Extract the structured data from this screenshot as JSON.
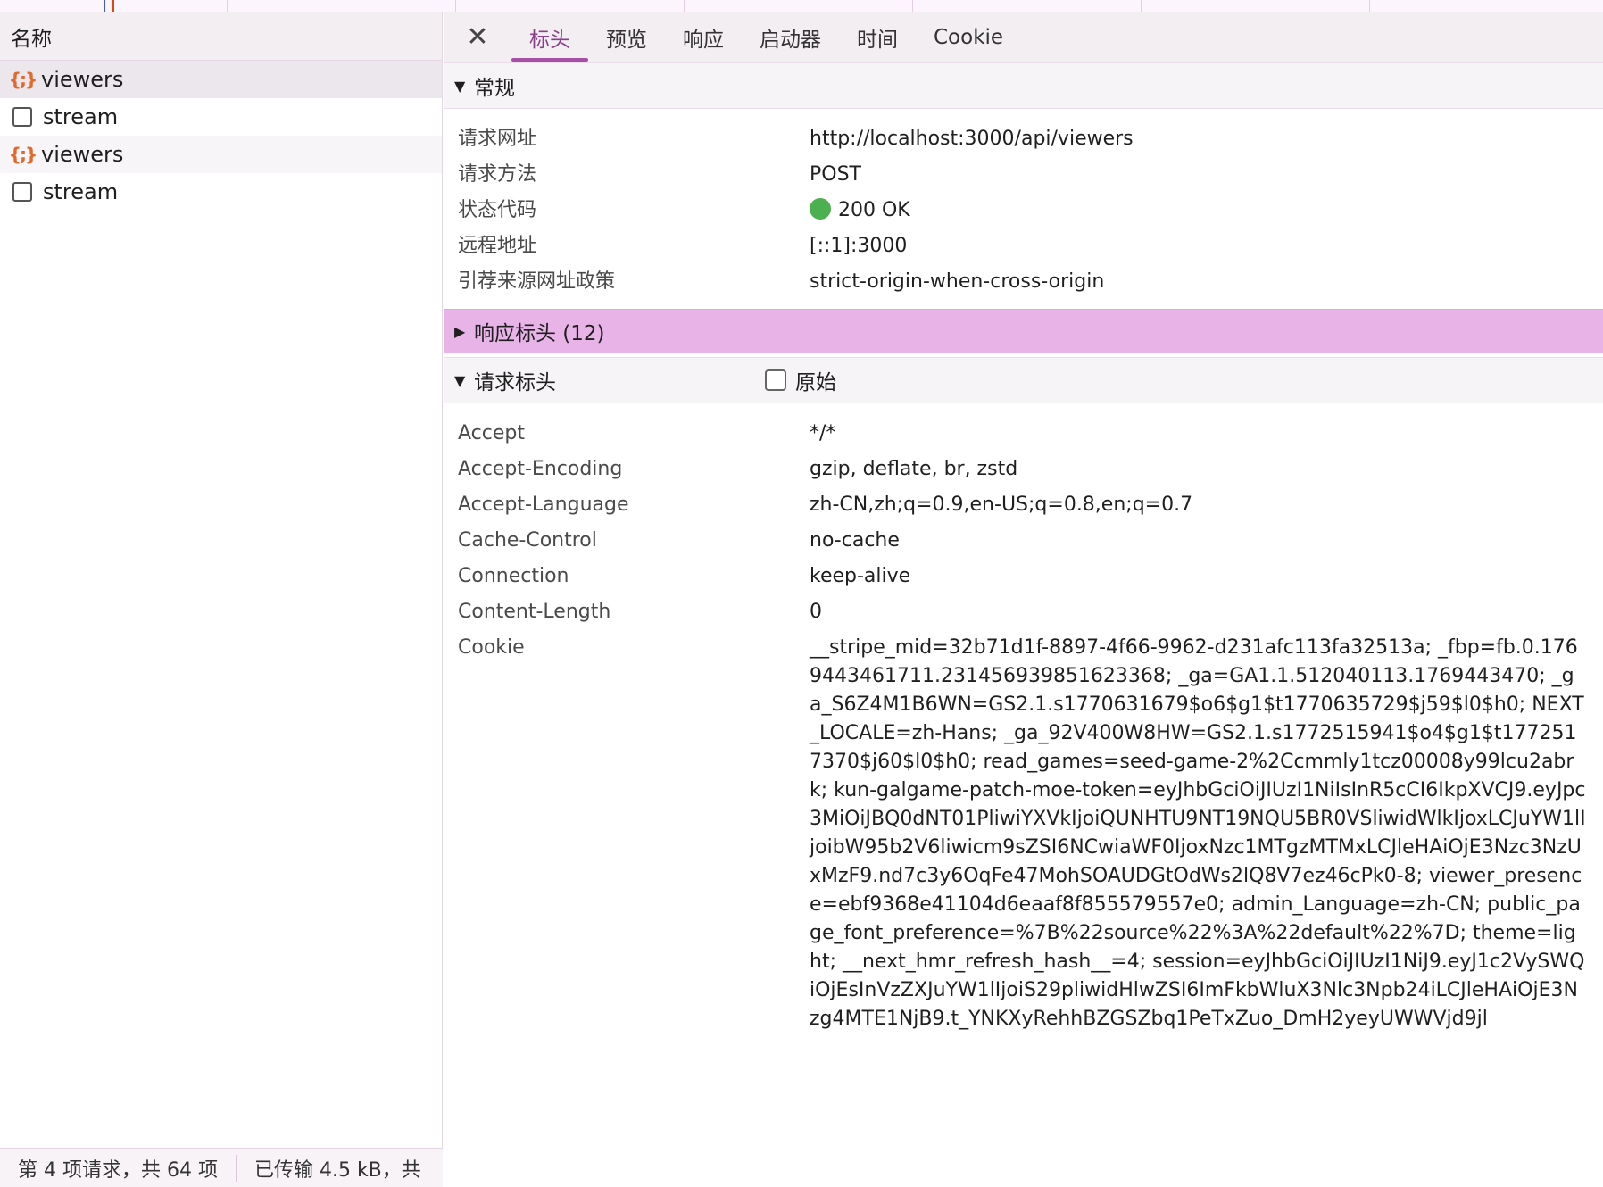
{
  "left_panel": {
    "column_header": "名称",
    "requests": [
      {
        "name": "viewers",
        "type": "fetch-icon"
      },
      {
        "name": "stream",
        "type": "document-icon"
      },
      {
        "name": "viewers",
        "type": "fetch-icon"
      },
      {
        "name": "stream",
        "type": "document-icon"
      }
    ],
    "status": {
      "requests_count": "第 4 项请求，共 64 项",
      "transferred": "已传输 4.5 kB，共"
    }
  },
  "tabs": {
    "close_icon": "close-icon",
    "items": [
      "标头",
      "预览",
      "响应",
      "启动器",
      "时间",
      "Cookie"
    ],
    "active_index": 0
  },
  "general": {
    "title": "常规",
    "rows": [
      {
        "key": "请求网址",
        "value": "http://localhost:3000/api/viewers"
      },
      {
        "key": "请求方法",
        "value": "POST"
      },
      {
        "key": "状态代码",
        "value": "200 OK"
      },
      {
        "key": "远程地址",
        "value": "[::1]:3000"
      },
      {
        "key": "引荐来源网址政策",
        "value": "strict-origin-when-cross-origin"
      }
    ]
  },
  "response_headers": {
    "title": "响应标头 (12)",
    "collapsed": true
  },
  "request_headers": {
    "title": "请求标头",
    "raw_label": "原始",
    "rows": [
      {
        "key": "Accept",
        "value": "*/*"
      },
      {
        "key": "Accept-Encoding",
        "value": "gzip, deflate, br, zstd"
      },
      {
        "key": "Accept-Language",
        "value": "zh-CN,zh;q=0.9,en-US;q=0.8,en;q=0.7"
      },
      {
        "key": "Cache-Control",
        "value": "no-cache"
      },
      {
        "key": "Connection",
        "value": "keep-alive"
      },
      {
        "key": "Content-Length",
        "value": "0"
      },
      {
        "key": "Cookie",
        "value": "__stripe_mid=32b71d1f-8897-4f66-9962-d231afc113fa32513a; _fbp=fb.0.1769443461711.231456939851623368; _ga=GA1.1.512040113.1769443470; _ga_S6Z4M1B6WN=GS2.1.s1770631679$o6$g1$t1770635729$j59$l0$h0; NEXT_LOCALE=zh-Hans; _ga_92V400W8HW=GS2.1.s1772515941$o4$g1$t1772517370$j60$l0$h0; read_games=seed-game-2%2Ccmmly1tcz00008y99lcu2abrk; kun-galgame-patch-moe-token=eyJhbGciOiJIUzI1NiIsInR5cCI6IkpXVCJ9.eyJpc3MiOiJBQ0dNT01PliwiYXVkIjoiQUNHTU9NT19NQU5BR0VSliwidWlkIjoxLCJuYW1lIjoibW95b2V6liwicm9sZSI6NCwiaWF0IjoxNzc1MTgzMTMxLCJleHAiOjE3Nzc3NzUxMzF9.nd7c3y6OqFe47MohSOAUDGtOdWs2lQ8V7ez46cPk0-8; viewer_presence=ebf9368e41104d6eaaf8f855579557e0; admin_Language=zh-CN; public_page_font_preference=%7B%22source%22%3A%22default%22%7D; theme=light; __next_hmr_refresh_hash__=4; session=eyJhbGciOiJIUzI1NiJ9.eyJ1c2VySWQiOjEsInVzZXJuYW1lIjoiS29pliwidHlwZSI6ImFkbWluX3Nlc3Npb24iLCJleHAiOjE3Nzg4MTE1NjB9.t_YNKXyRehhBZGSZbq1PeTxZuo_DmH2yeyUWWVjd9jl"
      }
    ]
  },
  "colors": {
    "accent": "#a550a5",
    "highlight_row": "#e8b4e8",
    "status_ok": "#4caf50",
    "fetch_icon": "#e0692b"
  }
}
